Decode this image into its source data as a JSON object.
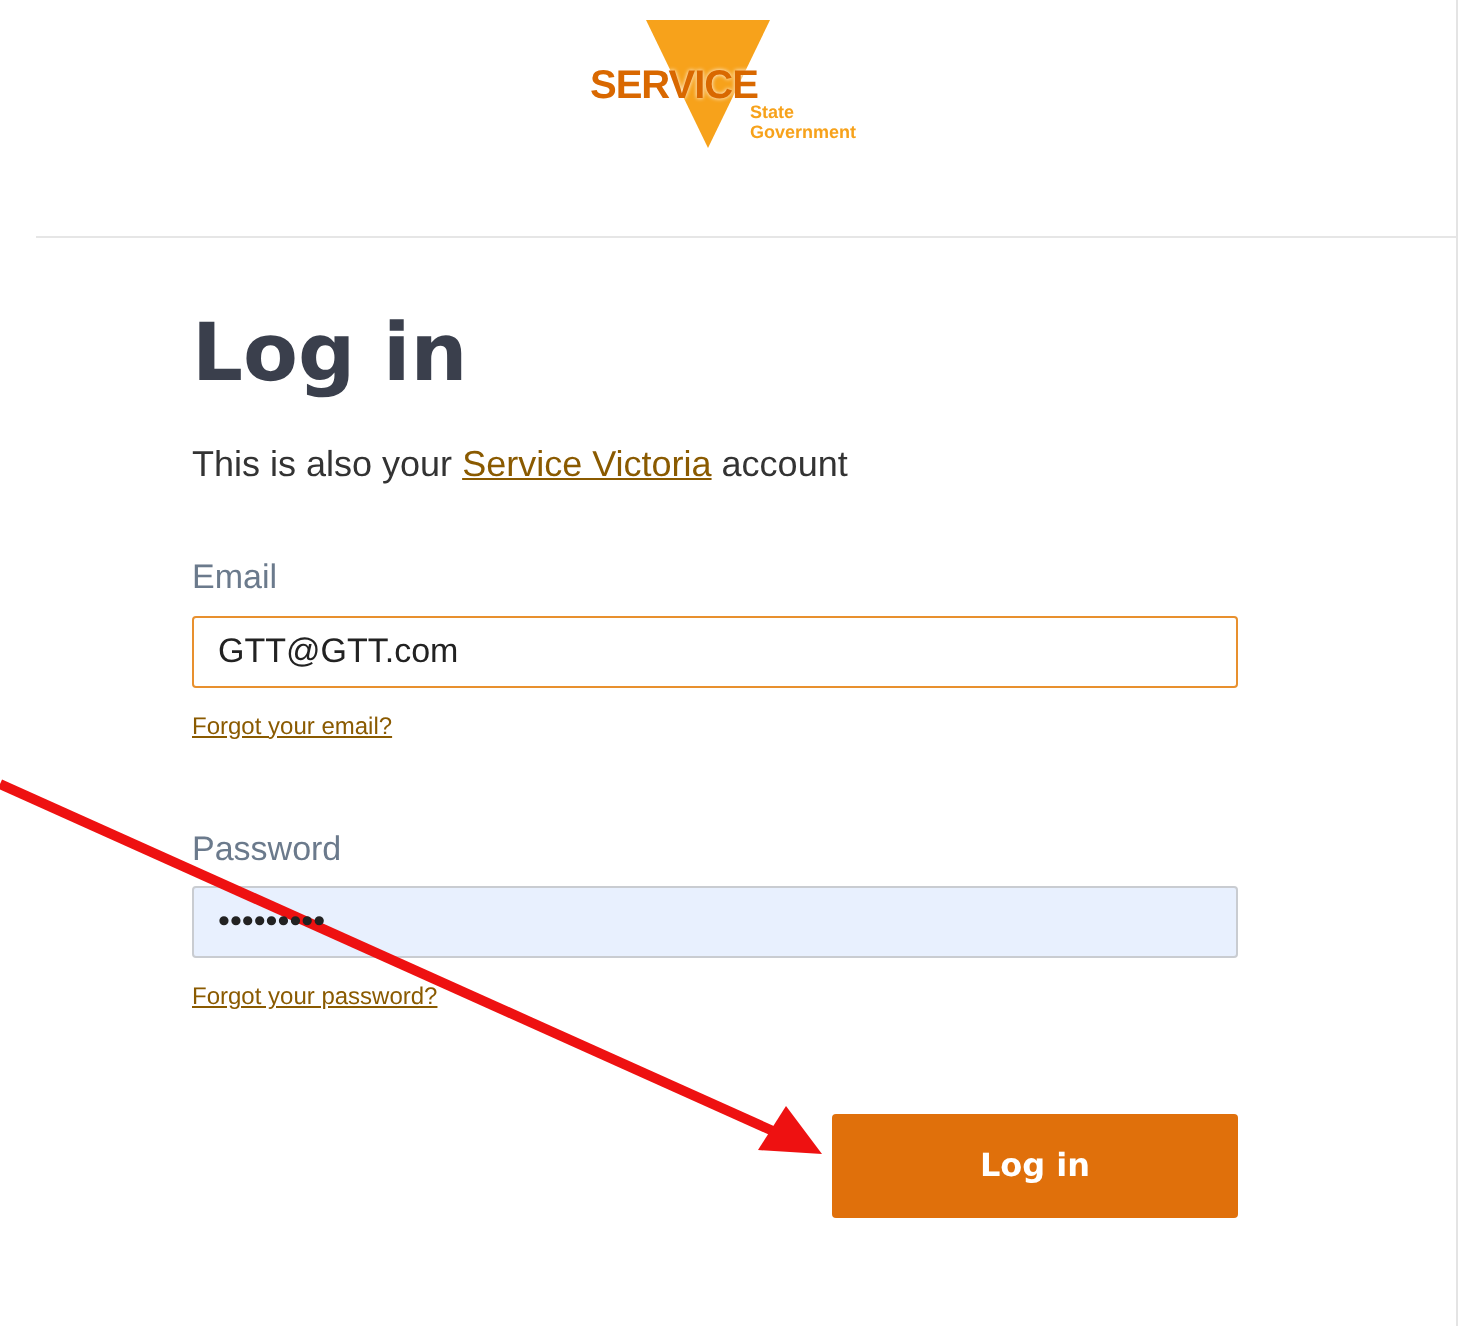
{
  "logo": {
    "wordmark": "SERVICE",
    "line_1": "State",
    "line_2": "Government"
  },
  "heading": "Log in",
  "intro": {
    "before": "This is also your",
    "link": "Service Victoria",
    "after": "account"
  },
  "email": {
    "label": "Email",
    "value": "GTT@GTT.com",
    "focused": true,
    "link": "Forgot your email?"
  },
  "password": {
    "label": "Password",
    "value": "•••••••••",
    "autofilled": true,
    "link": "Forgot your password?"
  },
  "submit": "Log in"
}
